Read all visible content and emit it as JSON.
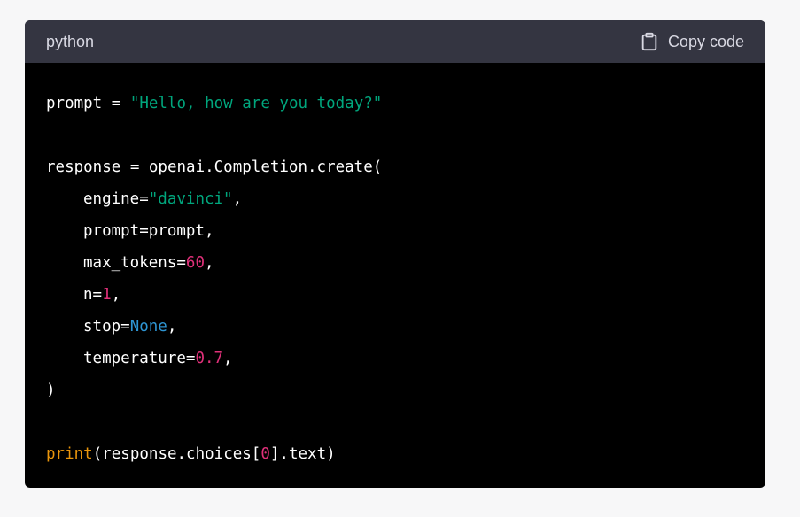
{
  "header": {
    "language": "python",
    "copy_label": "Copy code",
    "copy_icon": "clipboard-icon"
  },
  "code": {
    "l1_var": "prompt = ",
    "l1_str": "\"Hello, how are you today?\"",
    "l3": "response = openai.Completion.create(",
    "l4_key": "engine=",
    "l4_str": "\"davinci\"",
    "l4_end": ",",
    "l5": "prompt=prompt,",
    "l6_key": "max_tokens=",
    "l6_num": "60",
    "l6_end": ",",
    "l7_key": "n=",
    "l7_num": "1",
    "l7_end": ",",
    "l8_key": "stop=",
    "l8_kw": "None",
    "l8_end": ",",
    "l9_key": "temperature=",
    "l9_num": "0.7",
    "l9_end": ",",
    "l10": ")",
    "l12_fn": "print",
    "l12_a": "(response.choices[",
    "l12_num": "0",
    "l12_b": "].text)"
  },
  "colors": {
    "string": "#00a67d",
    "number": "#df3079",
    "keyword": "#2e95d3",
    "function": "#e9950c",
    "header_bg": "#343541",
    "code_bg": "#000000"
  }
}
